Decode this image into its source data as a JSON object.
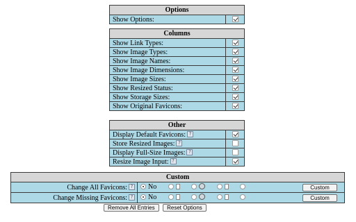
{
  "options": {
    "title": "Options",
    "items": [
      {
        "label": "Show Options:",
        "checked": true
      }
    ]
  },
  "columns": {
    "title": "Columns",
    "items": [
      {
        "label": "Show Link Types:",
        "checked": true
      },
      {
        "label": "Show Image Types:",
        "checked": true
      },
      {
        "label": "Show Image Names:",
        "checked": true
      },
      {
        "label": "Show Image Dimensions:",
        "checked": true
      },
      {
        "label": "Show Image Sizes:",
        "checked": true
      },
      {
        "label": "Show Resized Status:",
        "checked": true
      },
      {
        "label": "Show Storage Sizes:",
        "checked": true
      },
      {
        "label": "Show Original Favicons:",
        "checked": true
      }
    ]
  },
  "other": {
    "title": "Other",
    "help_glyph": "?",
    "items": [
      {
        "label": "Display Default Favicons:",
        "checked": true
      },
      {
        "label": "Store Resized Images:",
        "checked": false
      },
      {
        "label": "Display Full-Size Images:",
        "checked": false
      },
      {
        "label": "Resize Image Input:",
        "checked": true
      }
    ]
  },
  "custom": {
    "title": "Custom",
    "rows": [
      {
        "label": "Change All Favicons:",
        "no_label": "No",
        "custom_button": "Custom"
      },
      {
        "label": "Change Missing Favicons:",
        "no_label": "No",
        "custom_button": "Custom"
      }
    ]
  },
  "buttons": {
    "remove_all": "Remove All Entries",
    "reset": "Reset Options"
  }
}
